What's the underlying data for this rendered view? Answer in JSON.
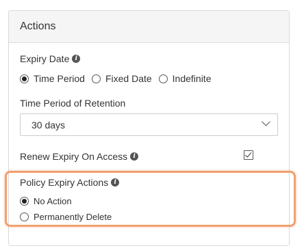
{
  "panel": {
    "title": "Actions"
  },
  "expiry_date": {
    "label": "Expiry Date",
    "info_icon": "info-icon",
    "options": [
      {
        "label": "Time Period",
        "selected": true
      },
      {
        "label": "Fixed Date",
        "selected": false
      },
      {
        "label": "Indefinite",
        "selected": false
      }
    ]
  },
  "retention": {
    "label": "Time Period of Retention",
    "selected_value": "30 days"
  },
  "renew": {
    "label": "Renew Expiry On Access",
    "checked": true
  },
  "policy_actions": {
    "label": "Policy Expiry Actions",
    "options": [
      {
        "label": "No Action",
        "selected": true
      },
      {
        "label": "Permanently Delete",
        "selected": false
      }
    ]
  },
  "colors": {
    "highlight": "#f0a070",
    "header_bg": "#f5f5f5",
    "border": "#d9d9d9"
  }
}
